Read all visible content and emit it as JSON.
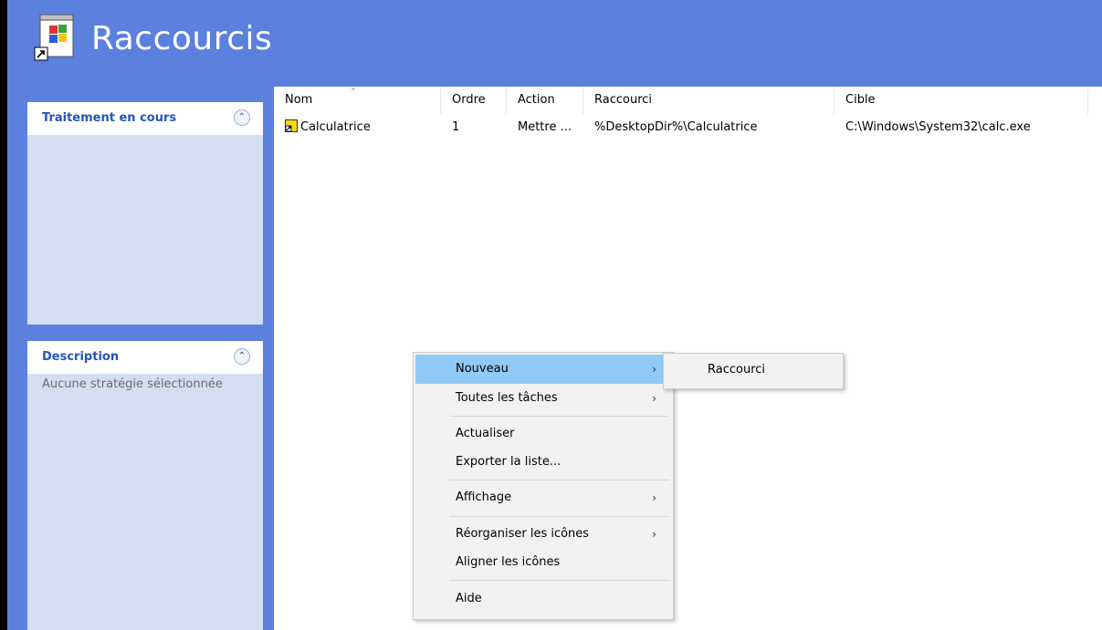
{
  "window": {
    "title": "Raccourcis",
    "header_color": "#5b80de"
  },
  "sidebar": {
    "panels": [
      {
        "title": "Traitement en cours",
        "body": ""
      },
      {
        "title": "Description",
        "body": "Aucune stratégie sélectionnée"
      }
    ]
  },
  "list": {
    "columns": [
      "Nom",
      "Ordre",
      "Action",
      "Raccourci",
      "Cible"
    ],
    "rows": [
      {
        "nom": "Calculatrice",
        "ordre": "1",
        "action": "Mettre ...",
        "raccourci": "%DesktopDir%\\Calculatrice",
        "cible": "C:\\Windows\\System32\\calc.exe"
      }
    ]
  },
  "context_menu": {
    "items": [
      {
        "label": "Nouveau",
        "has_submenu": true,
        "highlighted": true
      },
      {
        "label": "Toutes les tâches",
        "has_submenu": true
      },
      {
        "label": "Actualiser"
      },
      {
        "label": "Exporter la liste..."
      },
      {
        "label": "Affichage",
        "has_submenu": true
      },
      {
        "label": "Réorganiser les icônes",
        "has_submenu": true
      },
      {
        "label": "Aligner les icônes"
      },
      {
        "label": "Aide"
      }
    ],
    "submenu": {
      "items": [
        "Raccourci"
      ]
    }
  },
  "icons": {
    "app": "shortcut-window-icon",
    "row": "shortcut-icon",
    "collapse": "double-chevron-up-icon",
    "submenu_arrow": "chevron-right-icon"
  }
}
